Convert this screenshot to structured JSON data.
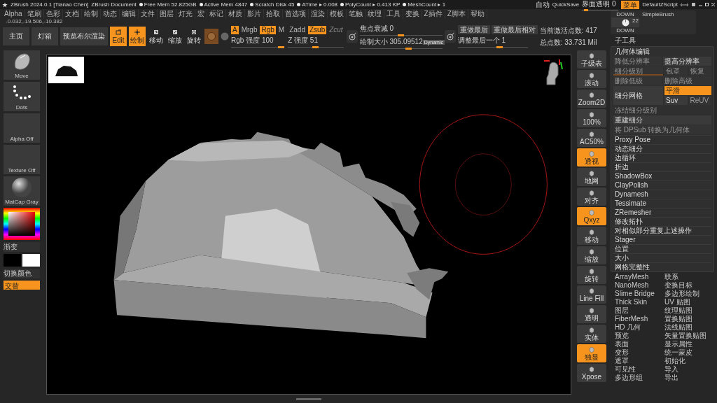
{
  "title_bar": {
    "app_title": "ZBrush 2024.0.1 [Tianao Chen]",
    "document": "ZBrush Document",
    "stats": [
      "Free Mem 52.825GB",
      "Active Mem 4847",
      "Scratch Disk 45",
      "ATime ▸ 0.008",
      "PolyCount ▸ 0.413 KP",
      "MeshCount ▸ 1"
    ],
    "autosave": "自动",
    "quicksave": "QuickSave",
    "transparency": {
      "label": "界面透明 0",
      "level": 0.05
    },
    "menu_button": "菜单",
    "script": "DefaultZScript"
  },
  "menu": [
    "Alpha",
    "笔刷",
    "色彩",
    "文档",
    "绘制",
    "动态",
    "编辑",
    "文件",
    "图层",
    "灯光",
    "宏",
    "标记",
    "材质",
    "影片",
    "拾取",
    "首选项",
    "渲染",
    "模板",
    "笔触",
    "纹理",
    "工具",
    "变换",
    "Z插件",
    "Z脚本",
    "帮助"
  ],
  "coordinates": "-0.032,-19.506,-10.382",
  "toolbar": {
    "buttons": [
      "主页",
      "灯箱",
      "预览布尔渲染"
    ],
    "tools": [
      {
        "label": "Edit",
        "selected": true
      },
      {
        "label": "绘制",
        "selected": true
      },
      {
        "label": "移动",
        "selected": false
      },
      {
        "label": "缩放",
        "selected": false
      },
      {
        "label": "旋转",
        "selected": false
      }
    ],
    "channels": [
      {
        "label": "A",
        "selected": true
      },
      {
        "label": "Mrgb",
        "selected": false
      },
      {
        "label": "Rgb",
        "selected": true
      },
      {
        "label": "M",
        "selected": false
      }
    ],
    "depth_modes": [
      {
        "label": "Zadd",
        "selected": false,
        "disabled": false
      },
      {
        "label": "Zsub",
        "selected": true,
        "disabled": false
      },
      {
        "label": "Zcut",
        "selected": false,
        "disabled": true
      }
    ],
    "intensity_sliders": [
      {
        "label": "Rgb 强度 100",
        "level": 0.95
      },
      {
        "label": "Z 强度 51",
        "level": 0.5
      }
    ],
    "draw_sliders": [
      {
        "label": "焦点衰减 0",
        "level": 0.5
      },
      {
        "label": "绘制大小 305.09512",
        "level": 0.6,
        "badge": "Dynamic"
      }
    ],
    "history_buttons": [
      "重做最后",
      "重做最后相对"
    ],
    "history_slider": {
      "label": "调整最后一个 1",
      "level": 0.6
    },
    "stats": [
      "当前激活点数: 417",
      "总点数: 33.731 Mil"
    ]
  },
  "brush_panel": {
    "top_label": "DOWN",
    "brush_name": "SimpleBrush",
    "size": "22",
    "bottom_label": "DOWN"
  },
  "shelf": [
    {
      "label": "Move",
      "kind": "brush"
    },
    {
      "label": "Dots",
      "kind": "stroke"
    },
    {
      "label": "Alpha Off",
      "kind": "empty"
    },
    {
      "label": "Texture Off",
      "kind": "empty"
    },
    {
      "label": "MatCap Gray",
      "kind": "material"
    }
  ],
  "color": {
    "gradient_label": "渐变",
    "switch_label": "切换颜色",
    "alternate": {
      "label": "交替",
      "selected": true
    }
  },
  "tray": [
    {
      "label": "子级表",
      "selected": false
    },
    {
      "label": "滚动",
      "selected": false
    },
    {
      "label": "Zoom2D",
      "selected": false
    },
    {
      "label": "100%",
      "selected": false
    },
    {
      "label": "AC50%",
      "selected": false
    },
    {
      "label": "透视",
      "selected": true
    },
    {
      "label": "地网",
      "selected": false
    },
    {
      "label": "对齐",
      "selected": false
    },
    {
      "label": "Qxyz",
      "selected": true
    },
    {
      "label": "移动",
      "selected": false
    },
    {
      "label": "缩放",
      "selected": false
    },
    {
      "label": "旋转",
      "selected": false
    },
    {
      "label": "Line Fill",
      "selected": false
    },
    {
      "label": "透明",
      "selected": false
    },
    {
      "label": "实体",
      "selected": false
    },
    {
      "label": "独显",
      "selected": true
    },
    {
      "label": "Xpose",
      "selected": false
    }
  ],
  "subtool_panel": {
    "title": "子工具",
    "section": "几何体编辑",
    "rows": [
      {
        "cells": [
          {
            "kind": "button",
            "label": "降低分辨率",
            "disabled": true
          },
          {
            "kind": "button",
            "label": "提高分辨率",
            "disabled": false
          }
        ]
      },
      {
        "cells": [
          {
            "kind": "slider",
            "label": "细分级别",
            "disabled": true
          },
          {
            "kind": "stack",
            "rows": [
              [
                {
                  "kind": "button",
                  "label": "包罩",
                  "disabled": true
                },
                {
                  "kind": "button",
                  "label": "恢复",
                  "disabled": true
                }
              ]
            ]
          }
        ]
      },
      {
        "cells": [
          {
            "kind": "button",
            "label": "删除低级",
            "disabled": true
          },
          {
            "kind": "button",
            "label": "删除高级",
            "disabled": true
          }
        ]
      },
      {
        "cells": [
          {
            "kind": "button",
            "label": "细分网格",
            "disabled": false
          },
          {
            "kind": "stack",
            "rows": [
              [
                {
                  "kind": "toggle",
                  "label": "平滑",
                  "selected": true,
                  "disabled": false
                }
              ],
              [
                {
                  "kind": "button",
                  "label": "Suv",
                  "disabled": false
                },
                {
                  "kind": "button",
                  "label": "ReUV",
                  "disabled": true
                }
              ]
            ]
          }
        ]
      },
      {
        "cells": [
          {
            "kind": "text",
            "label": "冻结细分级别",
            "disabled": true
          }
        ]
      },
      {
        "cells": [
          {
            "kind": "button",
            "label": "重建细分",
            "disabled": false
          }
        ]
      },
      {
        "cells": [
          {
            "kind": "button",
            "label": "将 DPSub 转换为几何体",
            "disabled": true
          }
        ]
      }
    ],
    "items": [
      "Proxy Pose",
      "动态细分",
      "边循环",
      "折边",
      "ShadowBox",
      "ClayPolish",
      "Dynamesh",
      "Tessimate",
      "ZRemesher",
      "修改拓扑",
      "对相似部分重复上述操作",
      "Stager",
      "位置",
      "大小",
      "网格完整性"
    ],
    "subpalettes": [
      "ArrayMesh",
      "NanoMesh",
      "Slime Bridge",
      "Thick Skin",
      "图层",
      "FiberMesh",
      "HD 几何",
      "预览",
      "表面",
      "变形",
      "遮罩",
      "可见性",
      "多边形组",
      "联系",
      "变换目标",
      "多边形绘制",
      "UV 贴图",
      "纹理贴图",
      "置换贴图",
      "法线贴图",
      "矢量置换贴图",
      "显示属性",
      "统一蒙皮",
      "初始化",
      "导入",
      "导出"
    ]
  }
}
